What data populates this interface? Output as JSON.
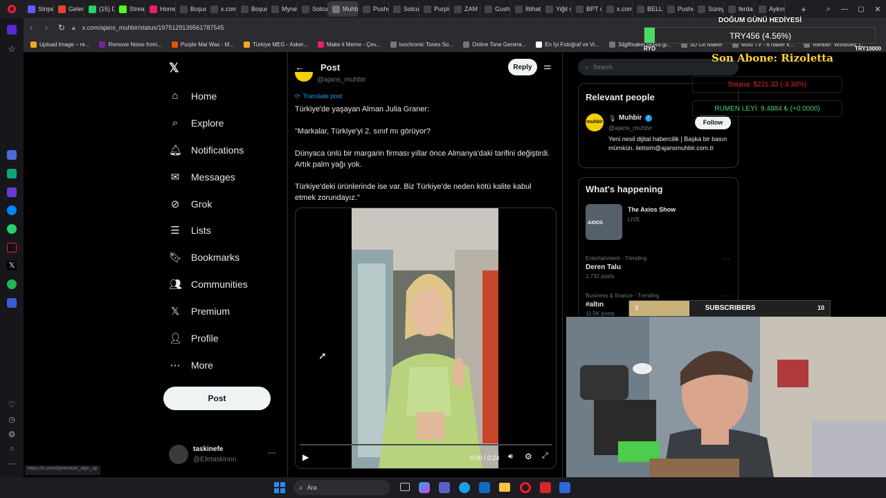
{
  "browser": {
    "tabs": [
      {
        "label": "Stripe",
        "color": "#635bff"
      },
      {
        "label": "Gelen",
        "color": "#ea4335"
      },
      {
        "label": "(15) D",
        "color": "#25d366"
      },
      {
        "label": "Stream",
        "color": "#53fc18"
      },
      {
        "label": "Home",
        "color": "#e91e63"
      },
      {
        "label": "Boşun",
        "color": "#444"
      },
      {
        "label": "x.com",
        "color": "#444"
      },
      {
        "label": "Boşun",
        "color": "#444"
      },
      {
        "label": "Mynet",
        "color": "#444"
      },
      {
        "label": "Solcu",
        "color": "#444"
      },
      {
        "label": "Muhbir",
        "color": "#777",
        "active": true
      },
      {
        "label": "Pushe",
        "color": "#444"
      },
      {
        "label": "Solcu",
        "color": "#444"
      },
      {
        "label": "Purple",
        "color": "#444"
      },
      {
        "label": "ZAM I",
        "color": "#444"
      },
      {
        "label": "Gushc",
        "color": "#444"
      },
      {
        "label": "İttihat",
        "color": "#444"
      },
      {
        "label": "Yiğit c",
        "color": "#444"
      },
      {
        "label": "BPT ol",
        "color": "#444"
      },
      {
        "label": "x.com",
        "color": "#444"
      },
      {
        "label": "BELL'S",
        "color": "#444"
      },
      {
        "label": "Pushe",
        "color": "#444"
      },
      {
        "label": "Süreyy",
        "color": "#444"
      },
      {
        "label": "ferda",
        "color": "#444"
      },
      {
        "label": "Aykırı",
        "color": "#444"
      }
    ],
    "url": "x.com/ajans_muhbir/status/1975129139561787545",
    "bookmarks": [
      {
        "label": "Upload Image – re...",
        "color": "#f5a623"
      },
      {
        "label": "Remove Noise from...",
        "color": "#7b1fa2"
      },
      {
        "label": "Purple Mat Wax - M...",
        "color": "#e65100"
      },
      {
        "label": "Türkiye MEG - Asker...",
        "color": "#f5a623"
      },
      {
        "label": "Make it Meme - Çev...",
        "color": "#e91e63"
      },
      {
        "label": "Isochronic Tones So...",
        "color": "#777"
      },
      {
        "label": "Online Tone Genera...",
        "color": "#777"
      },
      {
        "label": "En İyi Fotoğraf ve Vi...",
        "color": "#fff"
      },
      {
        "label": "3dgifmaker28349.gi...",
        "color": "#777"
      },
      {
        "label": "3D Gif Maker",
        "color": "#777"
      },
      {
        "label": "Multi TV - 6 haber k...",
        "color": "#777"
      },
      {
        "label": "Rehber: Windows T...",
        "color": "#777"
      }
    ]
  },
  "nav": {
    "items": [
      {
        "label": "Home",
        "icon": "home-icon"
      },
      {
        "label": "Explore",
        "icon": "search-icon"
      },
      {
        "label": "Notifications",
        "icon": "bell-icon"
      },
      {
        "label": "Messages",
        "icon": "mail-icon"
      },
      {
        "label": "Grok",
        "icon": "grok-icon"
      },
      {
        "label": "Lists",
        "icon": "list-icon"
      },
      {
        "label": "Bookmarks",
        "icon": "bookmark-icon"
      },
      {
        "label": "Communities",
        "icon": "people-icon"
      },
      {
        "label": "Premium",
        "icon": "x-icon"
      },
      {
        "label": "Profile",
        "icon": "person-icon"
      },
      {
        "label": "More",
        "icon": "more-icon"
      }
    ],
    "post_label": "Post",
    "account": {
      "name": "taskinefe",
      "handle": "@Efetaskinnn"
    }
  },
  "post": {
    "header_title": "Post",
    "reply_label": "Reply",
    "author_handle": "@ajans_muhbir",
    "translate_label": "Translate post",
    "paragraphs": [
      "Türkiye'de yaşayan Alman Julia Graner:",
      "\"Markalar, Türkiye'yi 2. sınıf mı görüyor?",
      "Dünyaca ünlü bir margarin firması yıllar önce Almanya'daki tarifini değiştirdi. Artık palm yağı yok.",
      "Türkiye'deki ürünlerinde ise var. Biz Türkiye'de neden kötü kalite kabul etmek zorundayız.\""
    ],
    "video_time": "0:00 / 0:24",
    "video_progress": 0
  },
  "right": {
    "search_placeholder": "Search",
    "relevant_title": "Relevant people",
    "person": {
      "name": "Muhbir",
      "handle": "@ajans_muhbir",
      "bio": "Yeni nesil dijital habercilik | Başka bir basın mümkün. iletisim@ajansmuhbir.com.tr",
      "follow_label": "Follow"
    },
    "happening_title": "What's happening",
    "show": {
      "title": "The Axios Show",
      "status": "LIVE",
      "thumb_label": "AXIOS"
    },
    "trends": [
      {
        "meta": "Entertainment · Trending",
        "name": "Deren Talu",
        "posts": "1,732 posts"
      },
      {
        "meta": "Business & finance · Trending",
        "name": "#altın",
        "posts": "11.5K posts"
      }
    ]
  },
  "overlay": {
    "goal_title": "DOĞUM GÜNÜ HEDİYESİ",
    "goal_amount": "TRY456 (4.56%)",
    "goal_progress": 0.0456,
    "goal_left": "RYO",
    "goal_right": "TRY10000",
    "last_sub": "Son Abone: Rizoletta",
    "solana": "Solana: $221.33 (-3.36%)",
    "rumen": "RUMEN LEYİ: 9.4884 ₺ (+0.0000)",
    "subs_count": "3",
    "subs_label": "SUBSCRIBERS",
    "subs_goal": "10",
    "subs_progress": 0.3
  },
  "taskbar": {
    "search_label": "Ara"
  },
  "status_url": "https://x.com/i/premium_sign_up"
}
